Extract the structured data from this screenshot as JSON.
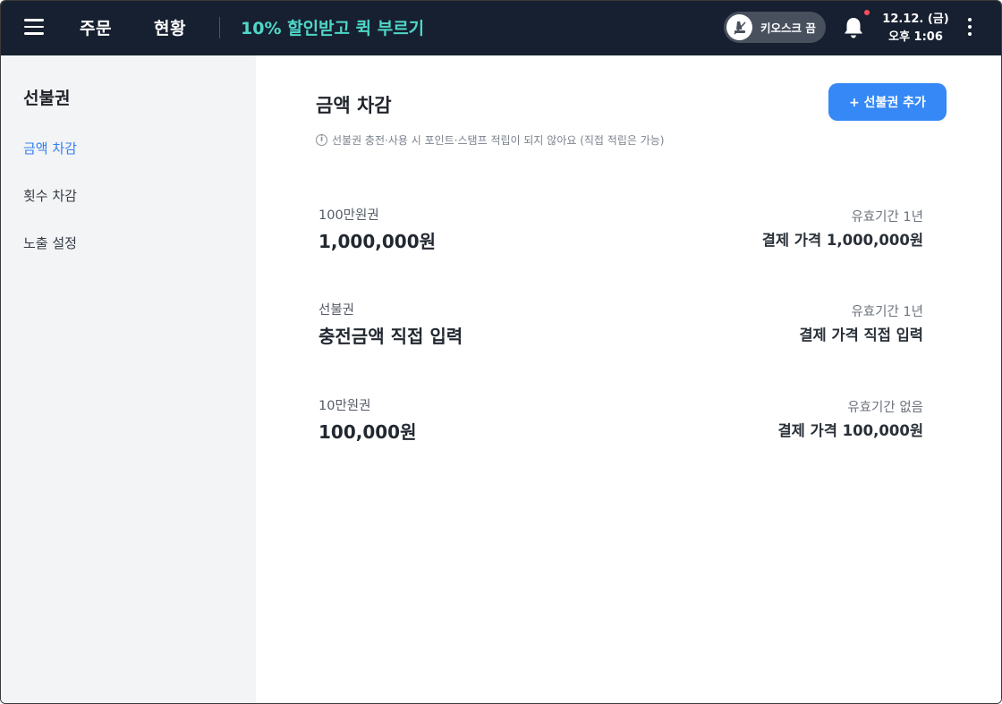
{
  "topbar": {
    "nav_order": "주문",
    "nav_status": "현황",
    "promo": "10% 할인받고 퀵 부르기",
    "kiosk_label": "키오스크 끔",
    "date": "12.12. (금)",
    "time": "오후 1:06",
    "has_notification": true
  },
  "sidebar": {
    "title": "선불권",
    "items": [
      {
        "label": "금액 차감",
        "active": true
      },
      {
        "label": "횟수 차감",
        "active": false
      },
      {
        "label": "노출 설정",
        "active": false
      }
    ]
  },
  "main": {
    "title": "금액 차감",
    "add_button": "+ 선불권 추가",
    "notice": "선불권 충전·사용 시 포인트·스탬프 적립이 되지 않아요 (직접 적립은 가능)",
    "vouchers": [
      {
        "name": "100만원권",
        "amount": "1,000,000원",
        "validity": "유효기간 1년",
        "price": "결제 가격 1,000,000원"
      },
      {
        "name": "선불권",
        "amount": "충전금액 직접 입력",
        "validity": "유효기간 1년",
        "price": "결제 가격 직접 입력"
      },
      {
        "name": "10만원권",
        "amount": "100,000원",
        "validity": "유효기간 없음",
        "price": "결제 가격 100,000원"
      }
    ]
  },
  "colors": {
    "topbar_bg": "#172030",
    "promo_text": "#4fd6c8",
    "accent_blue": "#3588f6",
    "sidebar_bg": "#f3f4f6",
    "notification_dot": "#ff4d5e"
  },
  "icons": {
    "menu": "hamburger-menu-icon",
    "kiosk": "kiosk-icon",
    "bell": "bell-icon",
    "more": "more-vertical-icon",
    "info": "info-icon"
  }
}
